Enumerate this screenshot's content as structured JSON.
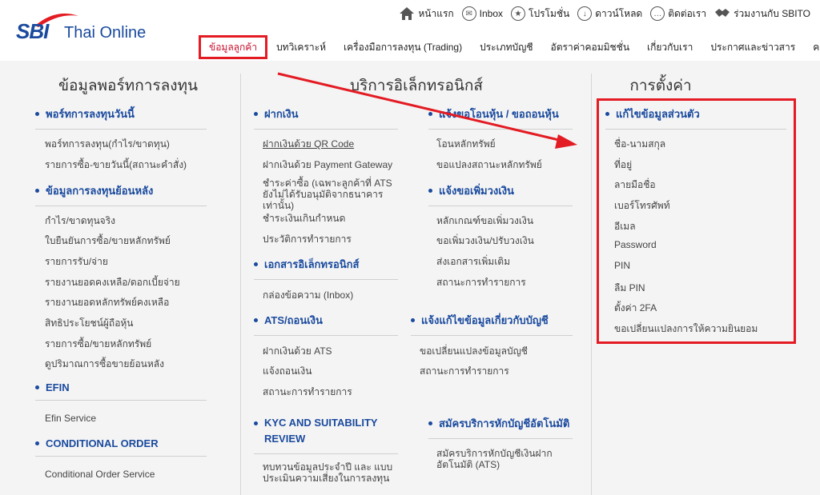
{
  "brand": {
    "logo_sbi": "SBI",
    "logo_text": "Thai Online"
  },
  "toplinks": [
    {
      "label": "หน้าแรก",
      "icon": "home-icon"
    },
    {
      "label": "Inbox",
      "icon": "mail-icon"
    },
    {
      "label": "โปรโมชั่น",
      "icon": "star-icon"
    },
    {
      "label": "ดาวน์โหลด",
      "icon": "download-icon"
    },
    {
      "label": "ติดต่อเรา",
      "icon": "chat-icon"
    },
    {
      "label": "ร่วมงานกับ SBITO",
      "icon": "handshake-icon"
    }
  ],
  "mainnav": [
    {
      "label": "ข้อมูลลูกค้า",
      "active": true
    },
    {
      "label": "บทวิเคราะห์"
    },
    {
      "label": "เครื่องมือการลงทุน (Trading)"
    },
    {
      "label": "ประเภทบัญชี"
    },
    {
      "label": "อัตราค่าคอมมิชชั่น"
    },
    {
      "label": "เกี่ยวกับเรา"
    },
    {
      "label": "ประกาศและข่าวสาร"
    },
    {
      "label": "คลังความรู้"
    }
  ],
  "col1": {
    "title": "ข้อมูลพอร์ทการลงทุน",
    "sections": [
      {
        "heading": "พอร์ทการลงทุนวันนี้",
        "links": [
          "พอร์ทการลงทุน(กำไร/ขาดทุน)",
          "รายการซื้อ-ขายวันนี้(สถานะคำสั่ง)"
        ]
      },
      {
        "heading": "ข้อมูลการลงทุนย้อนหลัง",
        "links": [
          "กำไร/ขาดทุนจริง",
          "ใบยืนยันการซื้อ/ขายหลักทรัพย์",
          "รายการรับ/จ่าย",
          "รายงานยอดคงเหลือ/ดอกเบี้ยจ่าย",
          "รายงานยอดหลักทรัพย์คงเหลือ",
          "สิทธิประโยชน์ผู้ถือหุ้น",
          "รายการซื้อ/ขายหลักทรัพย์",
          "ดูปริมาณการซื้อขายย้อนหลัง"
        ]
      },
      {
        "heading": "EFIN",
        "links": [
          "Efin Service"
        ]
      },
      {
        "heading": "CONDITIONAL ORDER",
        "links": [
          "Conditional Order Service"
        ]
      }
    ]
  },
  "col2": {
    "title": "บริการอิเล็กทรอนิกส์",
    "deposit": {
      "heading": "ฝากเงิน",
      "links": [
        "ฝากเงินด้วย QR Code",
        "ฝากเงินด้วย Payment Gateway",
        "ชำระค่าซื้อ (เฉพาะลูกค้าที่ ATS ยังไม่ได้รับอนุมัติจากธนาคารเท่านั้น)",
        "ชำระเงินเกินกำหนด",
        "ประวัติการทำรายการ"
      ]
    },
    "edocs": {
      "heading": "เอกสารอิเล็กทรอนิกส์",
      "links": [
        "กล่องข้อความ (Inbox)"
      ]
    },
    "ats": {
      "heading": "ATS/ถอนเงิน",
      "links": [
        "ฝากเงินด้วย ATS",
        "แจ้งถอนเงิน",
        "สถานะการทำรายการ"
      ]
    },
    "kyc": {
      "heading": "KYC AND SUITABILITY REVIEW",
      "links": [
        "ทบทวนข้อมูลประจำปี และ แบบประเมินความเสี่ยงในการลงทุน"
      ]
    },
    "transfer": {
      "heading": "แจ้งขอโอนหุ้น / ขอถอนหุ้น",
      "links": [
        "โอนหลักทรัพย์",
        "ขอแปลงสถานะหลักทรัพย์"
      ]
    },
    "credit": {
      "heading": "แจ้งขอเพิ่มวงเงิน",
      "links": [
        "หลักเกณฑ์ขอเพิ่มวงเงิน",
        "ขอเพิ่มวงเงิน/ปรับวงเงิน",
        "ส่งเอกสารเพิ่มเติม",
        "สถานะการทำรายการ"
      ]
    },
    "account": {
      "heading": "แจ้งแก้ไขข้อมูลเกี่ยวกับบัญชี",
      "links": [
        "ขอเปลี่ยนแปลงข้อมูลบัญชี",
        "สถานะการทำรายการ"
      ]
    },
    "autodebit": {
      "heading": "สมัครบริการหักบัญชีอัตโนมัติ",
      "links": [
        "สมัครบริการหักบัญชีเงินฝากอัตโนมัติ (ATS)"
      ]
    }
  },
  "col3": {
    "title": "การตั้งค่า",
    "section": {
      "heading": "แก้ไขข้อมูลส่วนตัว",
      "links": [
        "ชื่อ-นามสกุล",
        "ที่อยู่",
        "ลายมือชื่อ",
        "เบอร์โทรศัพท์",
        "อีเมล",
        "Password",
        "PIN",
        "ลืม PIN",
        "ตั้งค่า 2FA",
        "ขอเปลี่ยนแปลงการให้ความยินยอม"
      ]
    }
  },
  "colors": {
    "brand_blue": "#1a4a9e",
    "highlight_red": "#e31b23"
  }
}
